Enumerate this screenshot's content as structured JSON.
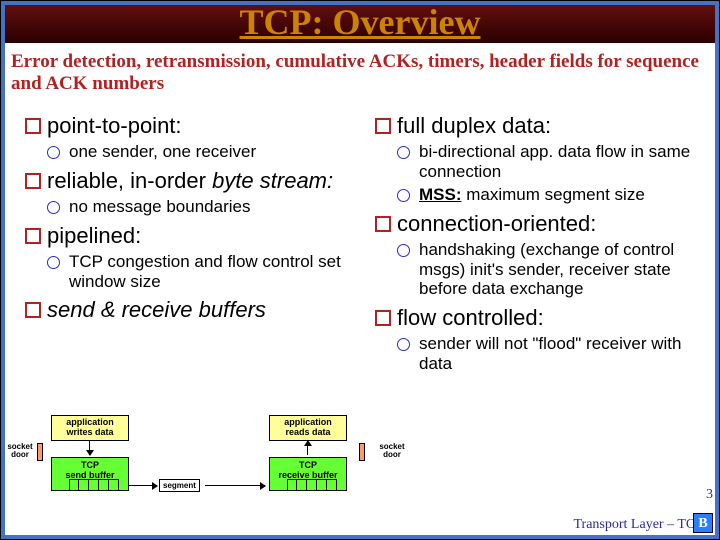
{
  "title": "TCP: Overview",
  "subtitle": "Error detection, retransmission, cumulative ACKs, timers, header fields for sequence and ACK numbers",
  "left": {
    "p2p": {
      "head": "point-to-point:",
      "sub": "one sender, one receiver"
    },
    "reliable": {
      "head_pre": "reliable, in-order ",
      "head_em": "byte stream:",
      "sub": "no message boundaries"
    },
    "pipelined": {
      "head": "pipelined:",
      "sub": "TCP congestion and flow control set window size"
    },
    "buffers": {
      "head": "send & receive buffers"
    }
  },
  "right": {
    "fullduplex": {
      "head": "full duplex data:",
      "sub1": "bi-directional app. data flow in same connection",
      "sub2_term": "MSS:",
      "sub2_rest": " maximum segment size"
    },
    "connoriented": {
      "head": "connection-oriented:",
      "sub": "handshaking (exchange of control msgs) init's sender, receiver state before data exchange"
    },
    "flowctrl": {
      "head": "flow controlled:",
      "sub": "sender will not \"flood\" receiver with data"
    }
  },
  "diagram": {
    "socket_door": "socket\ndoor",
    "app_writes": "application\nwrites data",
    "app_reads": "application\nreads data",
    "tcp_send": "TCP\nsend buffer",
    "tcp_recv": "TCP\nreceive buffer",
    "segment": "segment"
  },
  "footer": "Transport Layer – TCP",
  "page": "3",
  "badge": "B"
}
